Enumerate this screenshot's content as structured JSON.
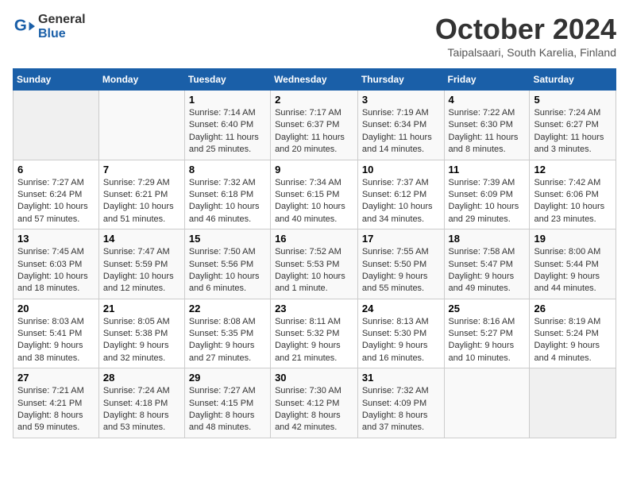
{
  "header": {
    "logo_general": "General",
    "logo_blue": "Blue",
    "title": "October 2024",
    "location": "Taipalsaari, South Karelia, Finland"
  },
  "days_of_week": [
    "Sunday",
    "Monday",
    "Tuesday",
    "Wednesday",
    "Thursday",
    "Friday",
    "Saturday"
  ],
  "weeks": [
    [
      {
        "day": "",
        "info": ""
      },
      {
        "day": "",
        "info": ""
      },
      {
        "day": "1",
        "info": "Sunrise: 7:14 AM\nSunset: 6:40 PM\nDaylight: 11 hours and 25 minutes."
      },
      {
        "day": "2",
        "info": "Sunrise: 7:17 AM\nSunset: 6:37 PM\nDaylight: 11 hours and 20 minutes."
      },
      {
        "day": "3",
        "info": "Sunrise: 7:19 AM\nSunset: 6:34 PM\nDaylight: 11 hours and 14 minutes."
      },
      {
        "day": "4",
        "info": "Sunrise: 7:22 AM\nSunset: 6:30 PM\nDaylight: 11 hours and 8 minutes."
      },
      {
        "day": "5",
        "info": "Sunrise: 7:24 AM\nSunset: 6:27 PM\nDaylight: 11 hours and 3 minutes."
      }
    ],
    [
      {
        "day": "6",
        "info": "Sunrise: 7:27 AM\nSunset: 6:24 PM\nDaylight: 10 hours and 57 minutes."
      },
      {
        "day": "7",
        "info": "Sunrise: 7:29 AM\nSunset: 6:21 PM\nDaylight: 10 hours and 51 minutes."
      },
      {
        "day": "8",
        "info": "Sunrise: 7:32 AM\nSunset: 6:18 PM\nDaylight: 10 hours and 46 minutes."
      },
      {
        "day": "9",
        "info": "Sunrise: 7:34 AM\nSunset: 6:15 PM\nDaylight: 10 hours and 40 minutes."
      },
      {
        "day": "10",
        "info": "Sunrise: 7:37 AM\nSunset: 6:12 PM\nDaylight: 10 hours and 34 minutes."
      },
      {
        "day": "11",
        "info": "Sunrise: 7:39 AM\nSunset: 6:09 PM\nDaylight: 10 hours and 29 minutes."
      },
      {
        "day": "12",
        "info": "Sunrise: 7:42 AM\nSunset: 6:06 PM\nDaylight: 10 hours and 23 minutes."
      }
    ],
    [
      {
        "day": "13",
        "info": "Sunrise: 7:45 AM\nSunset: 6:03 PM\nDaylight: 10 hours and 18 minutes."
      },
      {
        "day": "14",
        "info": "Sunrise: 7:47 AM\nSunset: 5:59 PM\nDaylight: 10 hours and 12 minutes."
      },
      {
        "day": "15",
        "info": "Sunrise: 7:50 AM\nSunset: 5:56 PM\nDaylight: 10 hours and 6 minutes."
      },
      {
        "day": "16",
        "info": "Sunrise: 7:52 AM\nSunset: 5:53 PM\nDaylight: 10 hours and 1 minute."
      },
      {
        "day": "17",
        "info": "Sunrise: 7:55 AM\nSunset: 5:50 PM\nDaylight: 9 hours and 55 minutes."
      },
      {
        "day": "18",
        "info": "Sunrise: 7:58 AM\nSunset: 5:47 PM\nDaylight: 9 hours and 49 minutes."
      },
      {
        "day": "19",
        "info": "Sunrise: 8:00 AM\nSunset: 5:44 PM\nDaylight: 9 hours and 44 minutes."
      }
    ],
    [
      {
        "day": "20",
        "info": "Sunrise: 8:03 AM\nSunset: 5:41 PM\nDaylight: 9 hours and 38 minutes."
      },
      {
        "day": "21",
        "info": "Sunrise: 8:05 AM\nSunset: 5:38 PM\nDaylight: 9 hours and 32 minutes."
      },
      {
        "day": "22",
        "info": "Sunrise: 8:08 AM\nSunset: 5:35 PM\nDaylight: 9 hours and 27 minutes."
      },
      {
        "day": "23",
        "info": "Sunrise: 8:11 AM\nSunset: 5:32 PM\nDaylight: 9 hours and 21 minutes."
      },
      {
        "day": "24",
        "info": "Sunrise: 8:13 AM\nSunset: 5:30 PM\nDaylight: 9 hours and 16 minutes."
      },
      {
        "day": "25",
        "info": "Sunrise: 8:16 AM\nSunset: 5:27 PM\nDaylight: 9 hours and 10 minutes."
      },
      {
        "day": "26",
        "info": "Sunrise: 8:19 AM\nSunset: 5:24 PM\nDaylight: 9 hours and 4 minutes."
      }
    ],
    [
      {
        "day": "27",
        "info": "Sunrise: 7:21 AM\nSunset: 4:21 PM\nDaylight: 8 hours and 59 minutes."
      },
      {
        "day": "28",
        "info": "Sunrise: 7:24 AM\nSunset: 4:18 PM\nDaylight: 8 hours and 53 minutes."
      },
      {
        "day": "29",
        "info": "Sunrise: 7:27 AM\nSunset: 4:15 PM\nDaylight: 8 hours and 48 minutes."
      },
      {
        "day": "30",
        "info": "Sunrise: 7:30 AM\nSunset: 4:12 PM\nDaylight: 8 hours and 42 minutes."
      },
      {
        "day": "31",
        "info": "Sunrise: 7:32 AM\nSunset: 4:09 PM\nDaylight: 8 hours and 37 minutes."
      },
      {
        "day": "",
        "info": ""
      },
      {
        "day": "",
        "info": ""
      }
    ]
  ]
}
